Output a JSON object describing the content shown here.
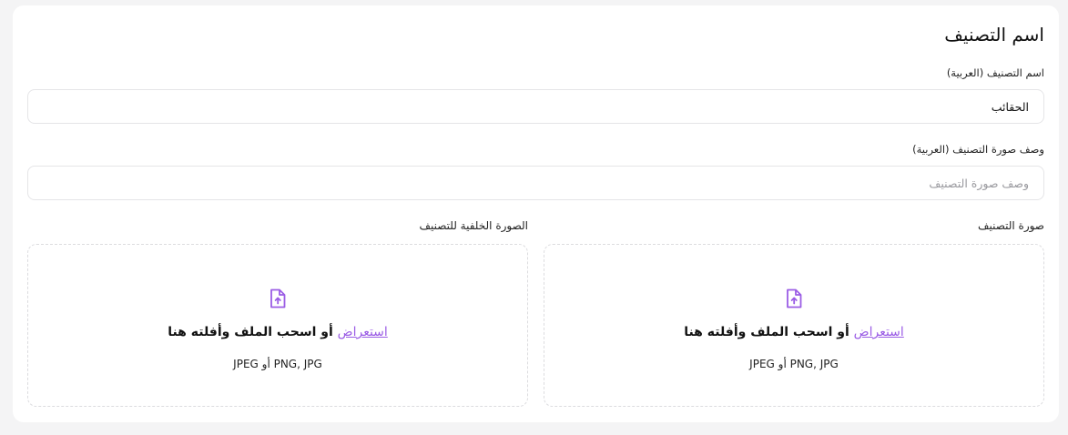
{
  "section": {
    "title": "اسم التصنيف"
  },
  "fields": {
    "name": {
      "label": "اسم التصنيف (العربية)",
      "value": "الحقائب"
    },
    "image_description": {
      "label": "وصف صورة التصنيف (العربية)",
      "placeholder": "وصف صورة التصنيف"
    }
  },
  "uploads": {
    "category_image": {
      "label": "صورة التصنيف",
      "browse": "استعراض",
      "drag_text": " أو اسحب الملف وأفلته هنا",
      "formats": "PNG, JPG أو JPEG"
    },
    "background_image": {
      "label": "الصورة الخلفية للتصنيف",
      "browse": "استعراض",
      "drag_text": " أو اسحب الملف وأفلته هنا",
      "formats": "PNG, JPG أو JPEG"
    }
  },
  "colors": {
    "accent": "#9b5de5",
    "border": "#e5e5e7",
    "page_bg": "#f4f4f5"
  }
}
